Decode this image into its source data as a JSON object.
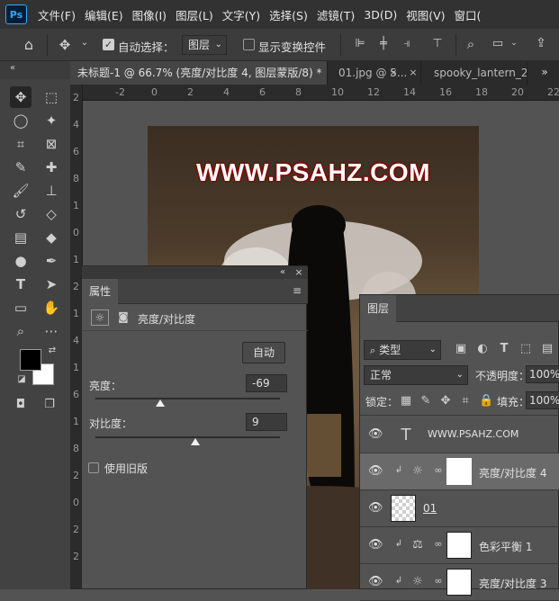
{
  "app": {
    "logo": "Ps"
  },
  "menu": [
    "文件(F)",
    "编辑(E)",
    "图像(I)",
    "图层(L)",
    "文字(Y)",
    "选择(S)",
    "滤镜(T)",
    "3D(D)",
    "视图(V)",
    "窗口("
  ],
  "options": {
    "auto_select_label": "自动选择：",
    "auto_select_checked": true,
    "target_value": "图层",
    "show_transform_label": "显示变换控件",
    "show_transform_checked": false
  },
  "tabs": [
    {
      "label": "未标题-1 @ 66.7% (亮度/对比度 4, 图层蒙版/8) *",
      "active": true
    },
    {
      "label": "01.jpg @ 5...",
      "active": false
    },
    {
      "label": "spooky_lantern_2...",
      "active": false
    }
  ],
  "ruler": {
    "top": [
      "-2",
      "0",
      "2",
      "4",
      "6",
      "8",
      "10",
      "12",
      "14",
      "16",
      "18",
      "20",
      "22"
    ],
    "left": [
      "2",
      "4",
      "6",
      "8",
      "1",
      "0",
      "1",
      "2",
      "1",
      "4",
      "1",
      "6",
      "1",
      "8",
      "2",
      "0",
      "2",
      "2"
    ]
  },
  "canvas": {
    "watermark": "WWW.PSAHZ.COM"
  },
  "properties": {
    "tab": "属性",
    "title": "亮度/对比度",
    "auto_button": "自动",
    "brightness_label": "亮度：",
    "brightness_value": "-69",
    "brightness_fraction": 0.35,
    "contrast_label": "对比度：",
    "contrast_value": "9",
    "contrast_fraction": 0.54,
    "legacy_label": "使用旧版",
    "legacy_checked": false
  },
  "layers": {
    "tab": "图层",
    "filter_label": "类型",
    "blend_mode": "正常",
    "opacity_label": "不透明度：",
    "opacity_value": "100%",
    "lock_label": "锁定：",
    "fill_label": "填充：",
    "fill_value": "100%",
    "items": [
      {
        "name": "WWW.PSAHZ.COM",
        "kind": "text",
        "selected": false
      },
      {
        "name": "亮度/对比度 4",
        "kind": "brightness",
        "selected": true
      },
      {
        "name": "01",
        "kind": "pixel",
        "selected": false
      },
      {
        "name": "色彩平衡 1",
        "kind": "balance",
        "selected": false
      },
      {
        "name": "亮度/对比度 3",
        "kind": "brightness",
        "selected": false
      }
    ]
  },
  "colors": {
    "foreground": "#000000",
    "background": "#ffffff",
    "watermark_outline": "#8a0000"
  }
}
